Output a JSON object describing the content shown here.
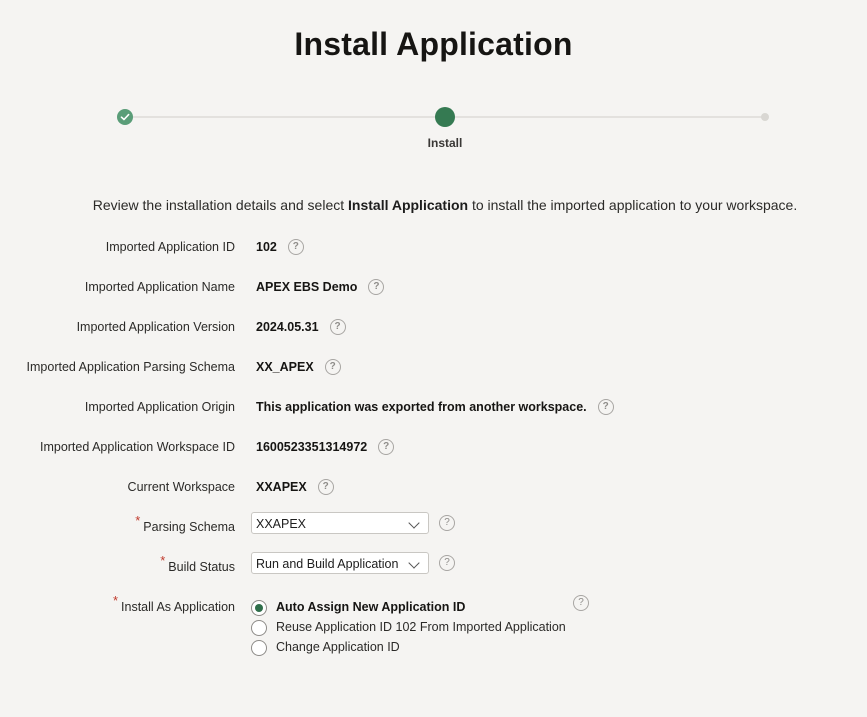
{
  "page": {
    "title": "Install Application",
    "intro_prefix": "Review the installation details and select ",
    "intro_bold": "Install Application",
    "intro_suffix": " to install the imported application to your workspace."
  },
  "wizard": {
    "current_step_label": "Install",
    "steps": [
      "completed",
      "current",
      "upcoming"
    ]
  },
  "details": [
    {
      "label": "Imported Application ID",
      "value": "102"
    },
    {
      "label": "Imported Application Name",
      "value": "APEX EBS Demo"
    },
    {
      "label": "Imported Application Version",
      "value": "2024.05.31"
    },
    {
      "label": "Imported Application Parsing Schema",
      "value": "XX_APEX"
    },
    {
      "label": "Imported Application Origin",
      "value": "This application was exported from another workspace."
    },
    {
      "label": "Imported Application Workspace ID",
      "value": "1600523351314972"
    },
    {
      "label": "Current Workspace",
      "value": "XXAPEX"
    }
  ],
  "form": {
    "parsing_schema": {
      "label": "Parsing Schema",
      "value": "XXAPEX"
    },
    "build_status": {
      "label": "Build Status",
      "value": "Run and Build Application"
    },
    "install_as": {
      "label": "Install As Application",
      "options": [
        {
          "label": "Auto Assign New Application ID",
          "selected": true
        },
        {
          "label": "Reuse Application ID 102 From Imported Application",
          "selected": false
        },
        {
          "label": "Change Application ID",
          "selected": false
        }
      ]
    },
    "required_marker": "*"
  },
  "help_glyph": "?",
  "colors": {
    "accent": "#357a52",
    "completed": "#5a9d78",
    "required": "#c0392b",
    "background": "#f5f4f2"
  }
}
